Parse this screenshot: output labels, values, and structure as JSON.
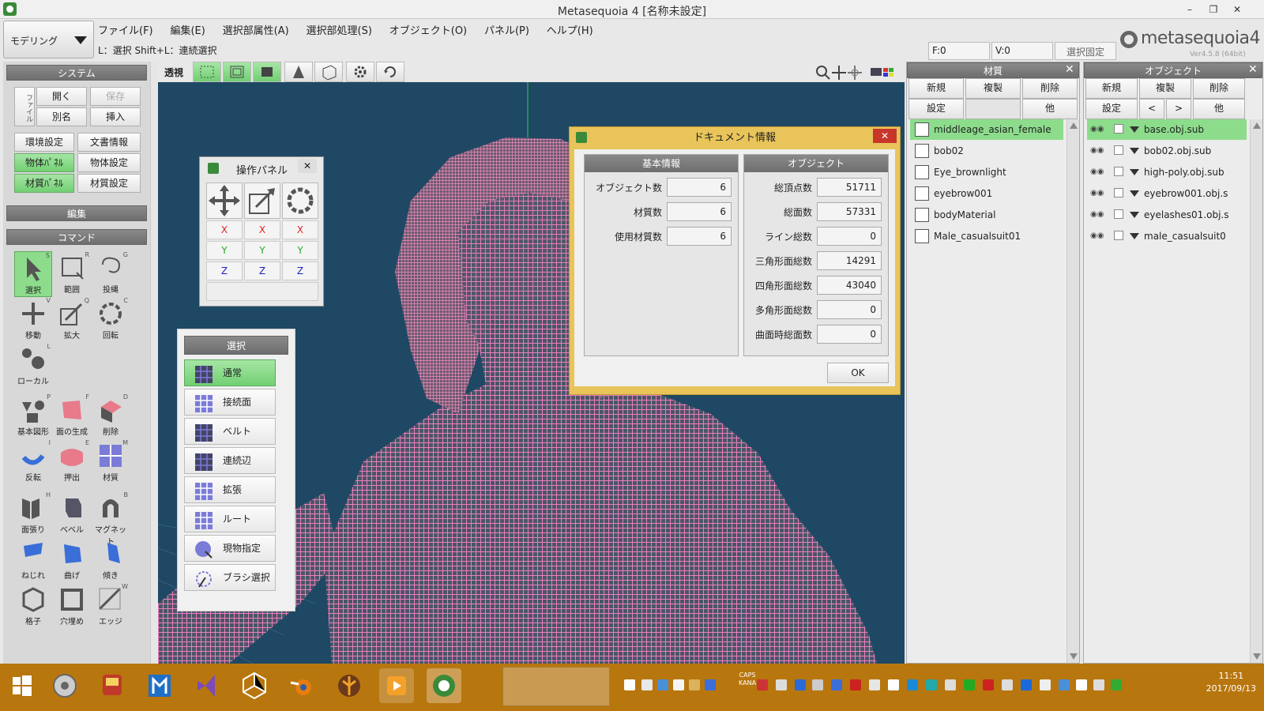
{
  "window": {
    "title": "Metasequoia 4 [名称未設定]",
    "min": "–",
    "restore": "❐",
    "close": "✕"
  },
  "mode": {
    "label": "モデリング"
  },
  "menu": [
    "ファイル(F)",
    "編集(E)",
    "選択部属性(A)",
    "選択部処理(S)",
    "オブジェクト(O)",
    "パネル(P)",
    "ヘルプ(H)"
  ],
  "status": {
    "hint": "L：選択  Shift+L：連続選択",
    "f": "F:0",
    "v": "V:0",
    "lock": "選択固定"
  },
  "logo": {
    "brand": "metasequoia4",
    "version": "Ver4.5.8 (64bit)"
  },
  "system": {
    "header": "システム",
    "side_tab": "ファイル",
    "open": "開く",
    "save": "保存",
    "saveas": "別名",
    "insert": "挿入",
    "env": "環境設定",
    "docinfo": "文書情報",
    "objpanel": "物体ﾊﾟﾈﾙ",
    "objsettings": "物体設定",
    "matpanel": "材質ﾊﾟﾈﾙ",
    "matsettings": "材質設定"
  },
  "edit_header": "編集",
  "command_header": "コマンド",
  "tools": [
    {
      "label": "選択",
      "key": "S"
    },
    {
      "label": "範囲",
      "key": "R"
    },
    {
      "label": "投縄",
      "key": "G"
    },
    {
      "label": "移動",
      "key": "V"
    },
    {
      "label": "拡大",
      "key": "Q"
    },
    {
      "label": "回転",
      "key": "C"
    },
    {
      "label": "ローカル",
      "key": "L"
    },
    {
      "label": "基本図形",
      "key": "P"
    },
    {
      "label": "面の生成",
      "key": "F"
    },
    {
      "label": "削除",
      "key": "D"
    },
    {
      "label": "反転",
      "key": "I"
    },
    {
      "label": "押出",
      "key": "E"
    },
    {
      "label": "材質",
      "key": "M"
    },
    {
      "label": "面張り",
      "key": "H"
    },
    {
      "label": "ベベル",
      "key": ""
    },
    {
      "label": "マグネット",
      "key": "B"
    },
    {
      "label": "ねじれ",
      "key": ""
    },
    {
      "label": "曲げ",
      "key": ""
    },
    {
      "label": "傾き",
      "key": ""
    },
    {
      "label": "格子",
      "key": ""
    },
    {
      "label": "穴埋め",
      "key": ""
    },
    {
      "label": "エッジ",
      "key": "W"
    }
  ],
  "view_toolbar": {
    "perspective": "透視"
  },
  "ops_panel": {
    "title": "操作パネル",
    "close": "✕",
    "x": "X",
    "y": "Y",
    "z": "Z"
  },
  "select_panel": {
    "title": "選択",
    "items": [
      "通常",
      "接続面",
      "ベルト",
      "連続辺",
      "拡張",
      "ルート",
      "現物指定",
      "ブラシ選択"
    ]
  },
  "doc_info": {
    "title": "ドキュメント情報",
    "close": "✕",
    "basic_header": "基本情報",
    "object_header": "オブジェクト",
    "basic": [
      {
        "k": "オブジェクト数",
        "v": "6"
      },
      {
        "k": "材質数",
        "v": "6"
      },
      {
        "k": "使用材質数",
        "v": "6"
      }
    ],
    "object": [
      {
        "k": "総頂点数",
        "v": "51711"
      },
      {
        "k": "総面数",
        "v": "57331"
      },
      {
        "k": "ライン総数",
        "v": "0"
      },
      {
        "k": "三角形面総数",
        "v": "14291"
      },
      {
        "k": "四角形面総数",
        "v": "43040"
      },
      {
        "k": "多角形面総数",
        "v": "0"
      },
      {
        "k": "曲面時総面数",
        "v": "0"
      }
    ],
    "ok": "OK"
  },
  "material_panel": {
    "title": "材質",
    "close": "✕",
    "new": "新規",
    "copy": "複製",
    "delete": "削除",
    "settings": "設定",
    "other": "他",
    "items": [
      "middleage_asian_female",
      "bob02",
      "Eye_brownlight",
      "eyebrow001",
      "bodyMaterial",
      "Male_casualsuit01"
    ]
  },
  "object_panel": {
    "title": "オブジェクト",
    "close": "✕",
    "new": "新規",
    "copy": "複製",
    "delete": "削除",
    "settings": "設定",
    "prev": "<",
    "next": ">",
    "other": "他",
    "items": [
      "base.obj.sub",
      "bob02.obj.sub",
      "high-poly.obj.sub",
      "eyebrow001.obj.s",
      "eyelashes01.obj.s",
      "male_casualsuit0"
    ]
  },
  "taskbar": {
    "time": "11:51",
    "date": "2017/09/13",
    "caps": "CAPS",
    "kana": "KANA"
  },
  "colors": {
    "accent_green": "#8cdc8c",
    "viewport": "#1f4864",
    "mesh": "#e879b8",
    "taskbar": "#b8760e",
    "dialog_border": "#e8c45a"
  }
}
